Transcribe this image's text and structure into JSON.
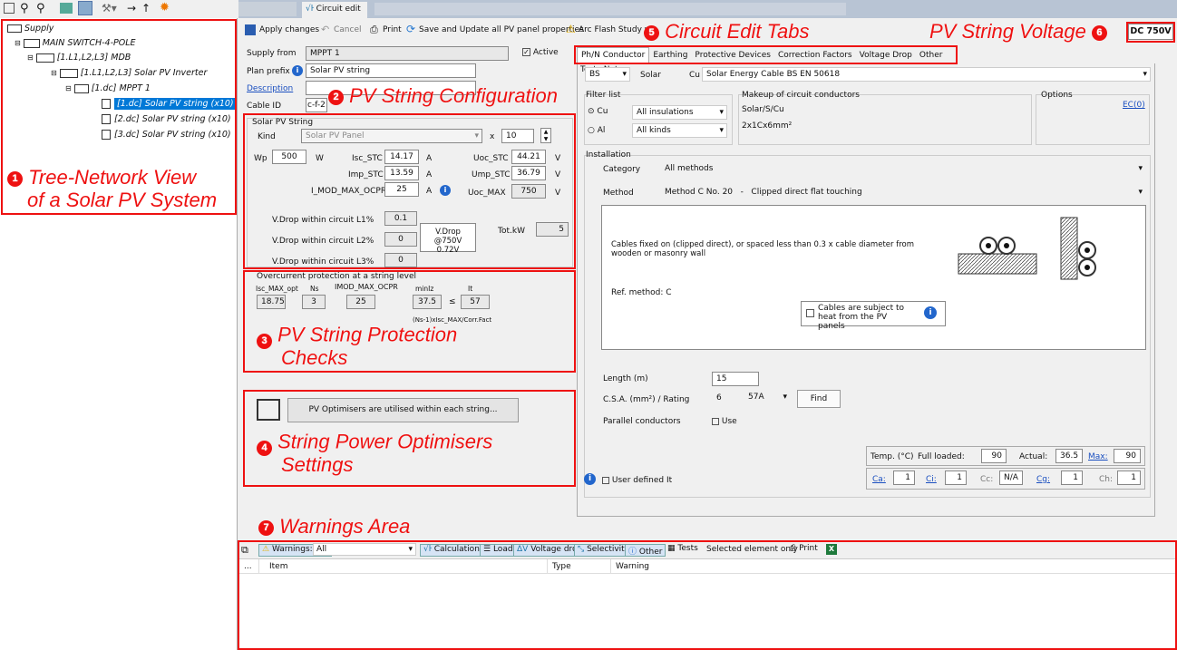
{
  "tree": {
    "items": [
      {
        "label": "Supply"
      },
      {
        "label": "MAIN SWITCH-4-POLE"
      },
      {
        "label": "[1.L1,L2,L3] MDB"
      },
      {
        "label": "[1.L1,L2,L3] Solar PV Inverter"
      },
      {
        "label": "[1.dc] MPPT 1"
      },
      {
        "label": "[1.dc] Solar PV string (x10)"
      },
      {
        "label": "[2.dc] Solar PV string (x10)"
      },
      {
        "label": "[3.dc] Solar PV string (x10)"
      }
    ]
  },
  "doc_tab": {
    "label": "Circuit edit"
  },
  "toolbar": {
    "apply": "Apply changes",
    "cancel": "Cancel",
    "print": "Print",
    "save": "Save and Update all PV panel properties",
    "arc": "Arc Flash Study"
  },
  "voltage_badge": "DC 750V",
  "annotations": {
    "a1": "Tree-Network View",
    "a1b": "of a Solar PV System",
    "n1": "1",
    "a2": "PV String Configuration",
    "n2": "2",
    "a3": "PV String Protection",
    "a3b": "Checks",
    "n3": "3",
    "a4": "String Power Optimisers",
    "a4b": "Settings",
    "n4": "4",
    "a5": "Circuit Edit Tabs",
    "n5": "5",
    "a6": "PV String Voltage",
    "n6": "6",
    "a7": "Warnings Area",
    "n7": "7"
  },
  "form": {
    "supply_from_label": "Supply from",
    "supply_from": "MPPT 1",
    "active": "Active",
    "plan_prefix_label": "Plan prefix",
    "plan_prefix": "Solar PV string",
    "description_label": "Description",
    "cable_id_label": "Cable ID",
    "cable_id": "c-f-2"
  },
  "pvstring": {
    "group": "Solar PV String",
    "kind_label": "Kind",
    "kind": "Solar PV Panel",
    "x": "x",
    "count": "10",
    "wp_label": "Wp",
    "wp": "500",
    "w": "W",
    "isc_label": "Isc_STC",
    "isc": "14.17",
    "a": "A",
    "uoc_label": "Uoc_STC",
    "uoc": "44.21",
    "v": "V",
    "imp_label": "Imp_STC",
    "imp": "13.59",
    "ump_label": "Ump_STC",
    "ump": "36.79",
    "imod_label": "I_MOD_MAX_OCPR",
    "imod": "25",
    "uocmax_label": "Uoc_MAX",
    "uocmax": "750",
    "vd1_label": "V.Drop within circuit L1%",
    "vd1": "0.1",
    "vd2_label": "V.Drop within circuit L2%",
    "vd2": "0",
    "vd3_label": "V.Drop within circuit L3%",
    "vd3": "0",
    "vdrop_box1": "V.Drop @750V",
    "vdrop_box2": "0.72V",
    "totkw_label": "Tot.kW",
    "totkw": "5"
  },
  "ocp": {
    "title": "Overcurrent protection at a string level",
    "h1": "Isc_MAX_opt",
    "h2": "Ns",
    "h3": "IMOD_MAX_OCPR",
    "h4": "minIz",
    "h5": "It",
    "v1": "18.75",
    "v2": "3",
    "v3": "25",
    "v4": "37.5",
    "le": "≤",
    "v5": "57",
    "formula": "(Ns-1)xIsc_MAX/Corr.Fact"
  },
  "optimiser": {
    "button": "PV Optimisers are utilised within each string..."
  },
  "tabs": [
    "Ph/N Conductor",
    "Earthing",
    "Protective Devices",
    "Correction Factors",
    "Voltage Drop",
    "Other",
    "Test",
    "Notes"
  ],
  "conductor": {
    "std": "BS",
    "type": "Solar",
    "mat": "Cu",
    "desc": "Solar Energy Cable BS EN 50618",
    "filter_label": "Filter list",
    "cu": "Cu",
    "al": "Al",
    "insul": "All insulations",
    "kinds": "All kinds",
    "makeup_label": "Makeup of circuit conductors",
    "makeup1": "Solar/S/Cu",
    "makeup2": "2x1Cx6mm²",
    "options_label": "Options",
    "ec": "EC(0)"
  },
  "installation": {
    "label": "Installation",
    "category_label": "Category",
    "category": "All methods",
    "method_label": "Method",
    "method": "Method C No. 20   -   Clipped direct flat touching",
    "desc": "Cables fixed on (clipped direct), or spaced less than 0.3 x cable diameter from wooden or masonry wall",
    "ref": "Ref. method: C",
    "heat": "Cables are subject to heat from the PV panels"
  },
  "length": {
    "label": "Length (m)",
    "value": "15",
    "csa_label": "C.S.A. (mm²) / Rating",
    "csa": "6",
    "rating": "57A",
    "find": "Find",
    "parallel_label": "Parallel conductors",
    "use": "Use"
  },
  "temps": {
    "label": "Temp. (°C)",
    "full_label": "Full loaded:",
    "full": "90",
    "actual_label": "Actual:",
    "actual": "36.5",
    "max_label": "Max:",
    "max": "90"
  },
  "factors": {
    "ca": "Ca:",
    "ca_v": "1",
    "ci": "Ci:",
    "ci_v": "1",
    "cc": "Cc:",
    "cc_v": "N/A",
    "cg": "Cg:",
    "cg_v": "1",
    "ch": "Ch:",
    "ch_v": "1"
  },
  "user_defined": "User defined It",
  "warnings": {
    "count": "Warnings: 0/0",
    "filter": "All",
    "calc": "Calculations",
    "load": "Load",
    "vdrop": "Voltage drop",
    "sel": "Selectivity",
    "other": "Other",
    "tests": "Tests",
    "selected": "Selected element only",
    "print": "Print",
    "col0": "...",
    "col1": "Item",
    "col2": "Type",
    "col3": "Warning"
  }
}
